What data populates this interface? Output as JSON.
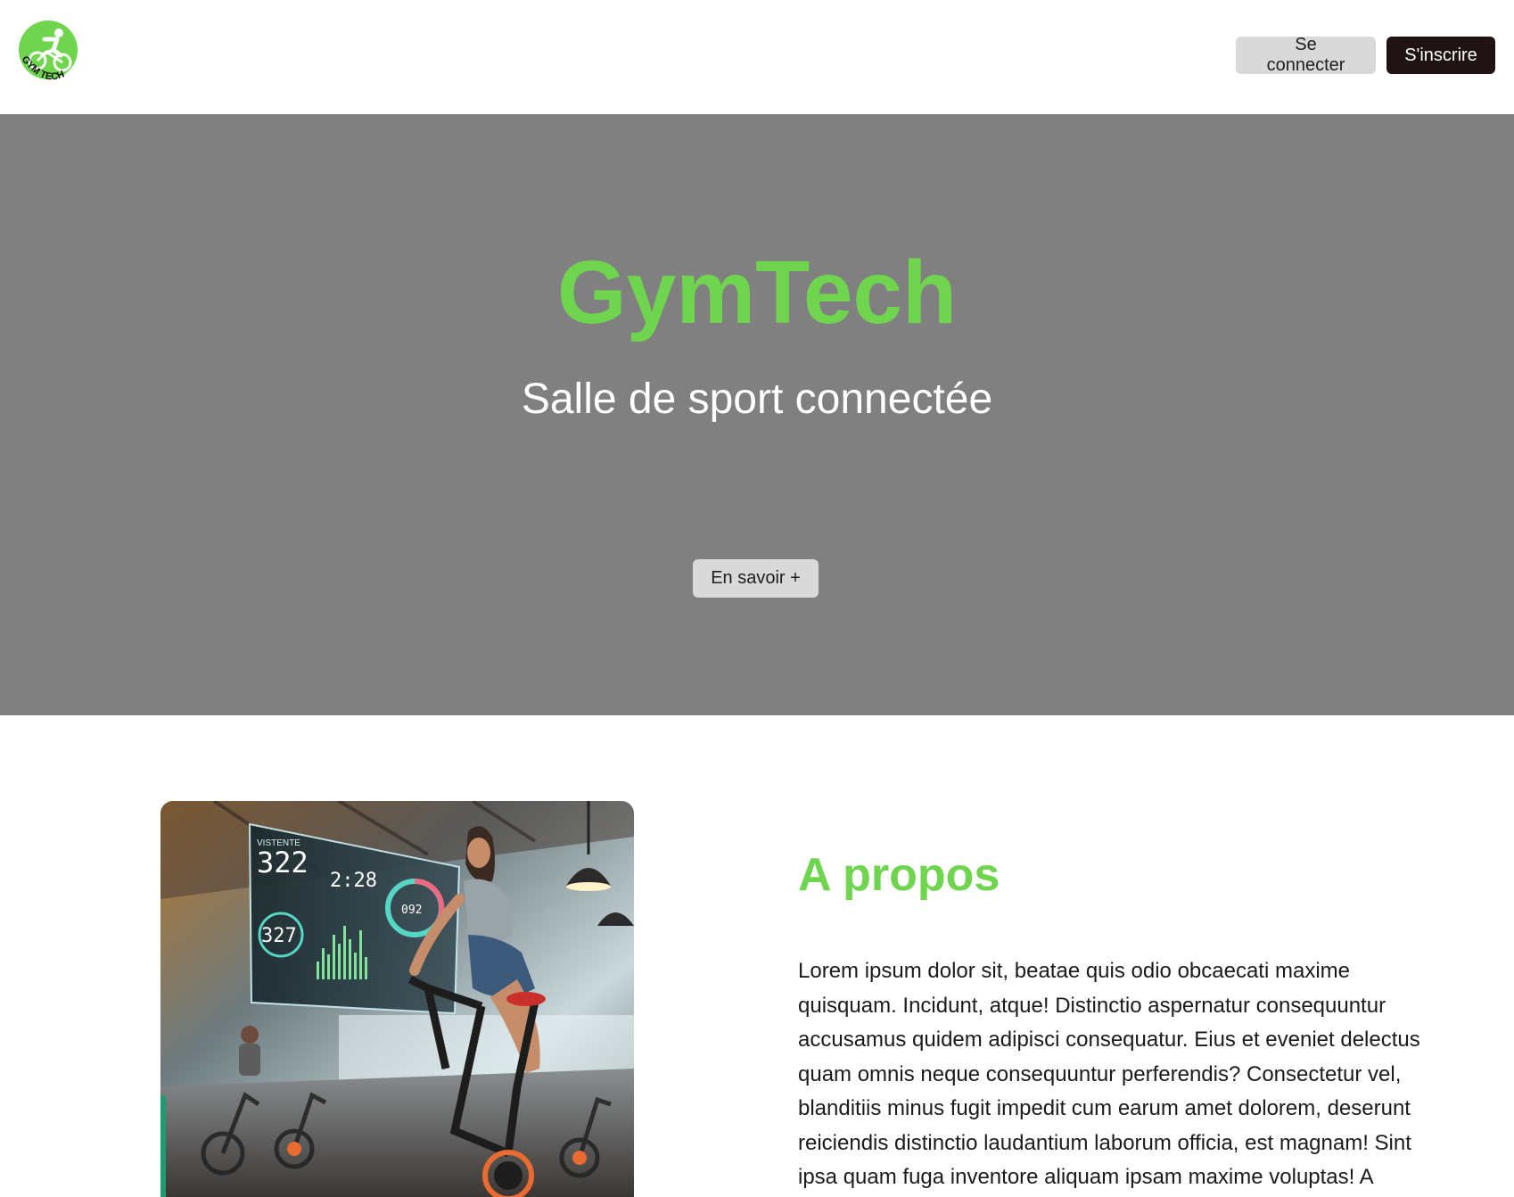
{
  "header": {
    "logo_text": "GYM TECH",
    "login_label": "Se connecter",
    "signup_label": "S'inscrire"
  },
  "hero": {
    "title": "GymTech",
    "subtitle": "Salle de sport connectée",
    "more_label": "En savoir +"
  },
  "about": {
    "title": "A propos",
    "text": "Lorem ipsum dolor sit, beatae quis odio obcaecati maxime quisquam. Incidunt, atque! Distinctio aspernatur consequuntur accusamus quidem adipisci consequatur. Eius et eveniet delectus quam omnis neque consequuntur perferendis? Consectetur vel, blanditiis minus fugit impedit cum earum amet dolorem, deserunt reiciendis distinctio laudantium laborum officia, est magnam! Sint ipsa quam fuga inventore aliquam ipsam maxime voluptas! A",
    "image": {
      "screen_label": "VISTENTE",
      "metric_main": "322",
      "metric_time": "2:28",
      "metric_ring": "092",
      "metric_circle": "327"
    }
  },
  "colors": {
    "accent": "#6fd54f",
    "hero_bg": "#808080",
    "dark_button": "#1f1413",
    "light_button": "#d9d9d9"
  },
  "icons": {
    "logo": "cyclist-logo-icon"
  }
}
